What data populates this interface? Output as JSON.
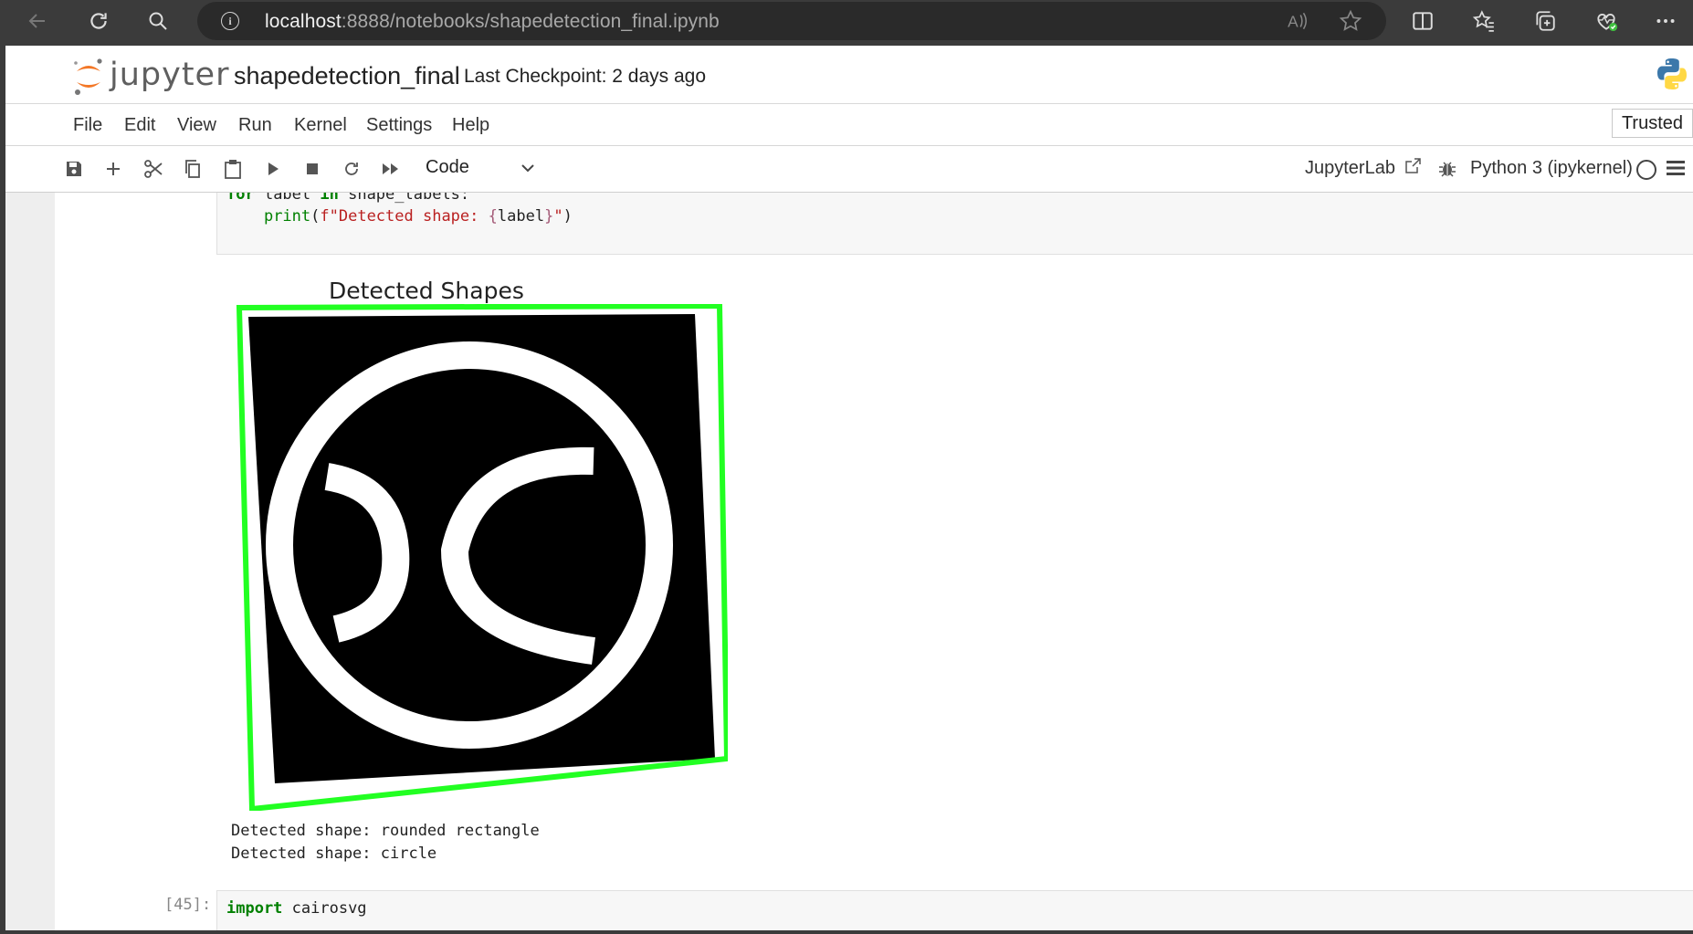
{
  "browser": {
    "url_host": "localhost",
    "url_rest": ":8888/notebooks/shapedetection_final.ipynb"
  },
  "header": {
    "logo_text": "jupyter",
    "notebook_title": "shapedetection_final",
    "checkpoint": "Last Checkpoint: 2 days ago"
  },
  "menu": {
    "items": [
      "File",
      "Edit",
      "View",
      "Run",
      "Kernel",
      "Settings",
      "Help"
    ],
    "trusted": "Trusted"
  },
  "toolbar": {
    "cell_type": "Code",
    "jupyterlab_link": "JupyterLab",
    "kernel_name": "Python 3 (ipykernel)"
  },
  "cells": {
    "code1_line1_a": "for",
    "code1_line1_b": " label ",
    "code1_line1_c": "in",
    "code1_line1_d": " shape_labels:",
    "code1_line2_indent": "    ",
    "code1_line2_fn": "print",
    "code1_line2_open": "(",
    "code1_line2_str1": "f\"Detected shape: ",
    "code1_line2_brace1": "{",
    "code1_line2_var": "label",
    "code1_line2_brace2": "}",
    "code1_line2_str2": "\"",
    "code1_line2_close": ")",
    "figure_title": "Detected Shapes",
    "output_line1": "Detected shape: rounded rectangle",
    "output_line2": "Detected shape: circle",
    "prompt2": "[45]:",
    "code2_kw": "import",
    "code2_rest": " cairosvg"
  },
  "colors": {
    "contour": "#22ff22",
    "accent_orange": "#f37726"
  }
}
